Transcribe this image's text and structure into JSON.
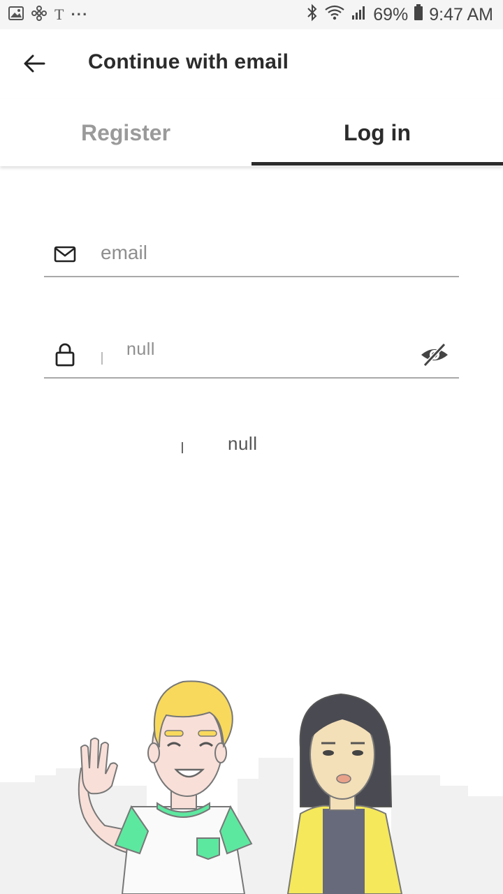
{
  "status_bar": {
    "battery_percent": "69%",
    "time": "9:47 AM",
    "left_icons": [
      "image-icon",
      "fan-icon",
      "t-icon",
      "more-dots-icon"
    ],
    "right_icons": [
      "bluetooth-icon",
      "wifi-icon",
      "signal-icon",
      "battery-icon"
    ]
  },
  "app_bar": {
    "title": "Continue with email",
    "back_icon": "arrow-left-icon"
  },
  "tabs": [
    {
      "label": "Register",
      "active": false
    },
    {
      "label": "Log in",
      "active": true
    }
  ],
  "form": {
    "email_placeholder": "email",
    "password_value": "null",
    "submit_label": "null"
  },
  "colors": {
    "active_tab": "#2b2b2b",
    "inactive_tab": "#9a9a9a",
    "underline": "#a9a9a9",
    "accent_green": "#5de8a0",
    "hair_blond": "#f8d95c",
    "jacket_yellow": "#f5e85a"
  }
}
